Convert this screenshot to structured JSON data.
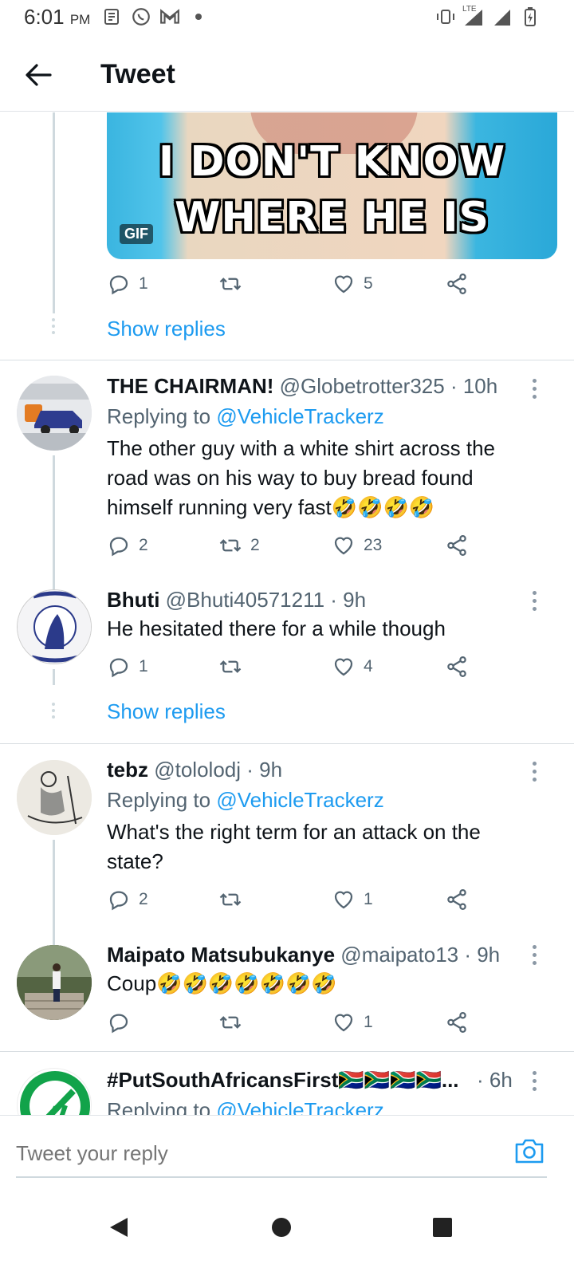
{
  "status_bar": {
    "time": "6:01",
    "ampm": "PM",
    "network": "LTE"
  },
  "header": {
    "title": "Tweet"
  },
  "gif": {
    "caption_line1": "I DON'T KNOW",
    "caption_line2": "WHERE HE IS",
    "badge": "GIF"
  },
  "top_tweet_actions": {
    "replies": "1",
    "retweets": "",
    "likes": "5"
  },
  "show_replies_label": "Show replies",
  "tweets": [
    {
      "name": "THE CHAIRMAN!",
      "handle": "@Globetrotter325",
      "time": "· 10h",
      "replying_prefix": "Replying to",
      "replying_handle": "@VehicleTrackerz",
      "text": "The other guy with a white shirt across the road was on his way to buy bread found himself running very fast🤣🤣🤣🤣",
      "replies": "2",
      "retweets": "2",
      "likes": "23"
    },
    {
      "name": "Bhuti",
      "handle": "@Bhuti40571211",
      "time": "· 9h",
      "text": "He hesitated there for a while though",
      "replies": "1",
      "retweets": "",
      "likes": "4"
    },
    {
      "name": "tebz",
      "handle": "@tololodj",
      "time": "· 9h",
      "replying_prefix": "Replying to",
      "replying_handle": "@VehicleTrackerz",
      "text": "What's the right term for an attack on the state?",
      "replies": "2",
      "retweets": "",
      "likes": "1"
    },
    {
      "name": "Maipato Matsubukanye",
      "handle": "@maipato13",
      "time": "· 9h",
      "text": "Coup🤣🤣🤣🤣🤣🤣🤣",
      "replies": "",
      "retweets": "",
      "likes": "1"
    },
    {
      "name": "#PutSouthAfricansFirst🇿🇦🇿🇦🇿🇦🇿🇦...",
      "handle": "",
      "time": "· 6h",
      "replying_prefix": "Replying to",
      "replying_handle": "@VehicleTrackerz"
    }
  ],
  "compose": {
    "placeholder": "Tweet your reply"
  },
  "colors": {
    "accent": "#1d9bf0",
    "text_secondary": "#536471",
    "divider": "#d9dee2"
  }
}
